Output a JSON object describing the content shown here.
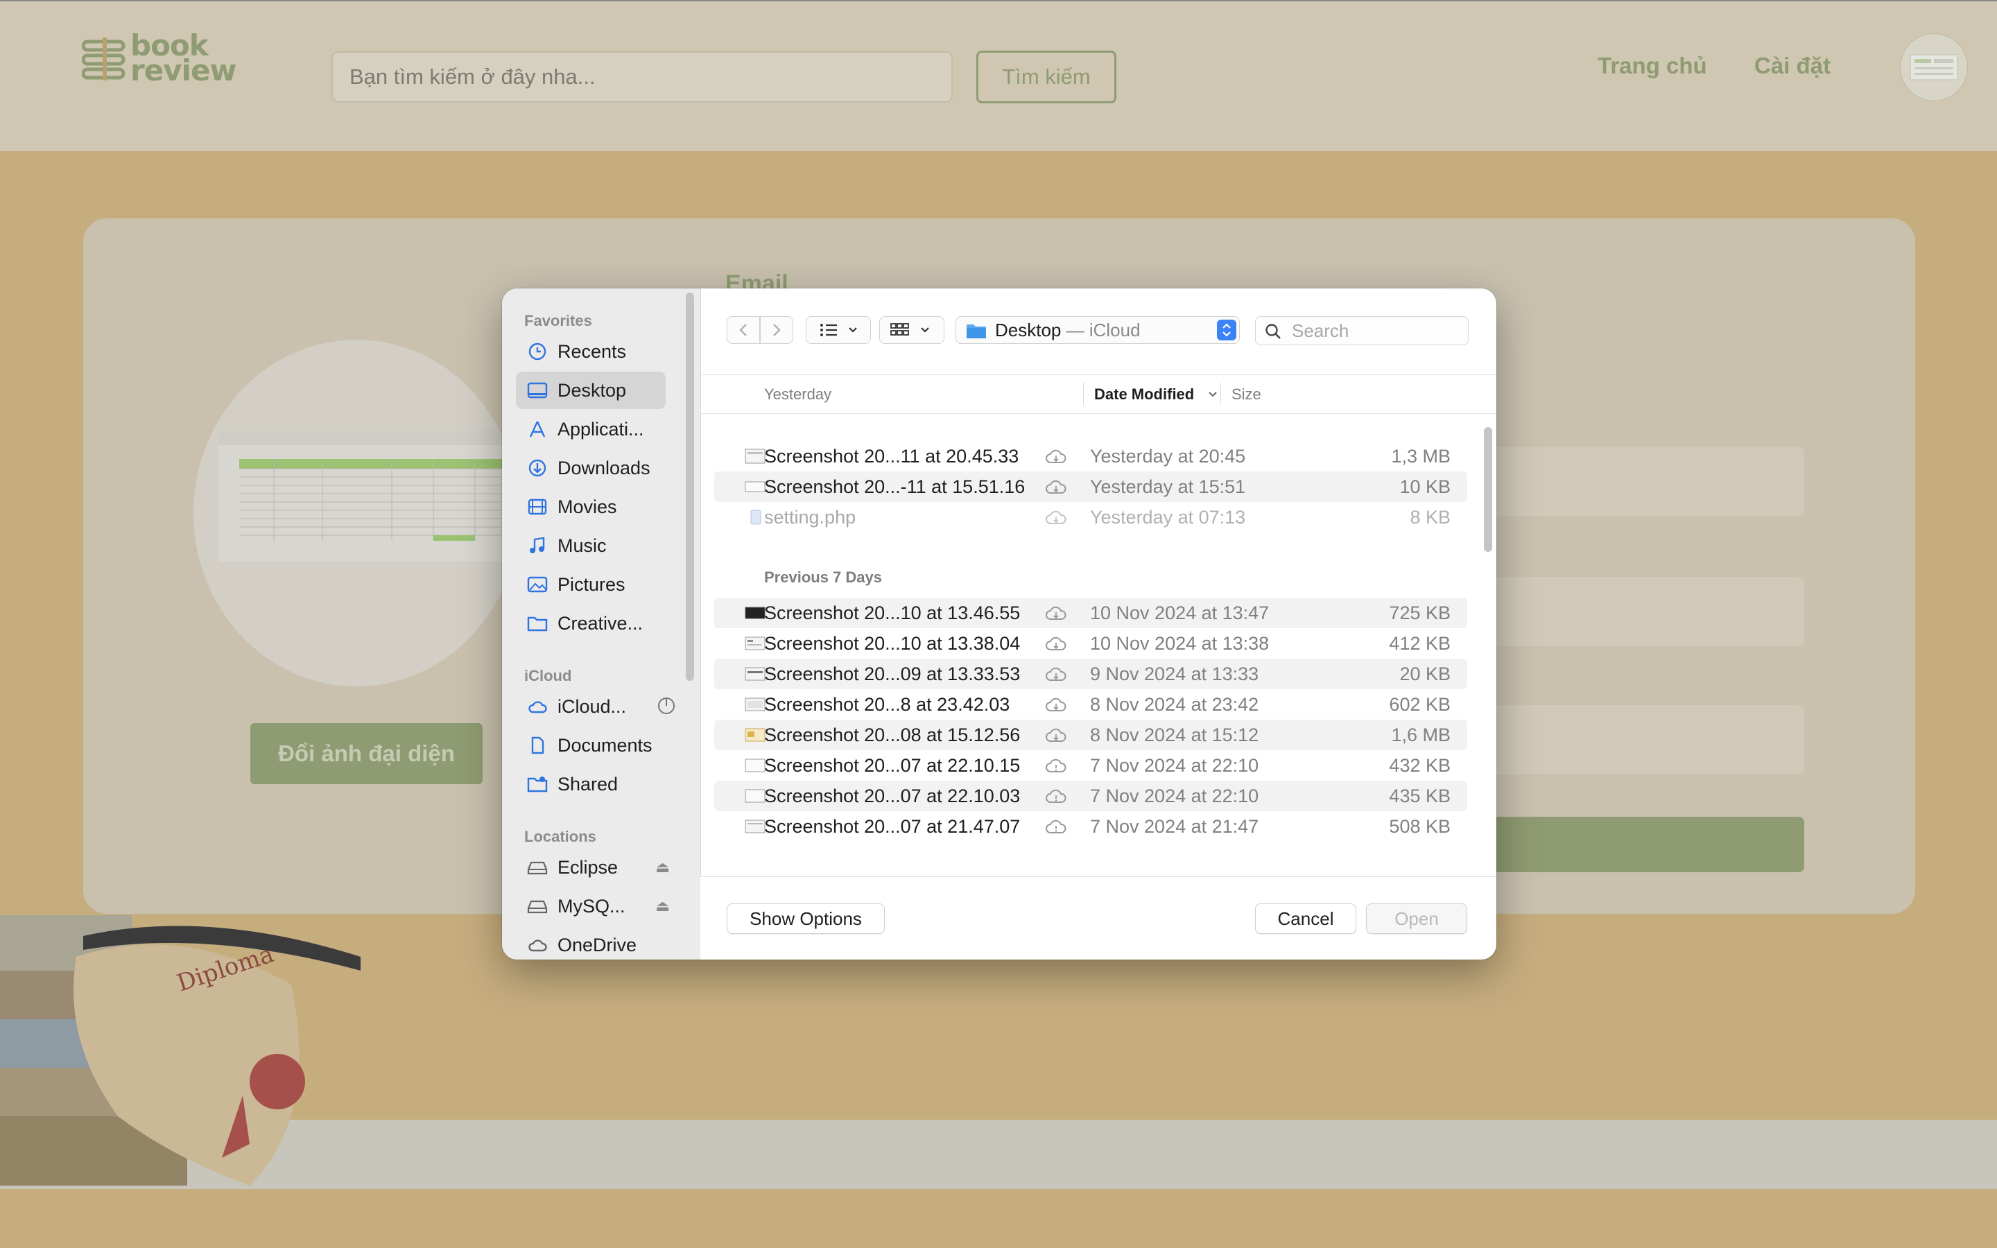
{
  "site": {
    "logo": {
      "line1": "book",
      "line2": "review"
    },
    "search": {
      "placeholder": "Bạn tìm kiếm ở đây nha...",
      "button": "Tìm kiếm"
    },
    "nav": {
      "home": "Trang chủ",
      "settings": "Cài đặt"
    },
    "profile": {
      "email_label": "Email",
      "change_avatar": "Đổi ảnh đại diện",
      "illustration_text": "Diploma"
    },
    "colors": {
      "brand": "#8f9b72",
      "header": "#cfc7b2",
      "background": "#c6ad7e"
    }
  },
  "dialog": {
    "sidebar": {
      "favorites_label": "Favorites",
      "favorites": [
        {
          "label": "Recents",
          "icon": "clock-icon"
        },
        {
          "label": "Desktop",
          "icon": "desktop-icon",
          "selected": true
        },
        {
          "label": "Applicati...",
          "icon": "applications-icon"
        },
        {
          "label": "Downloads",
          "icon": "download-icon"
        },
        {
          "label": "Movies",
          "icon": "film-icon"
        },
        {
          "label": "Music",
          "icon": "music-icon"
        },
        {
          "label": "Pictures",
          "icon": "photo-icon"
        },
        {
          "label": "Creative...",
          "icon": "folder-icon"
        }
      ],
      "icloud_label": "iCloud",
      "icloud": [
        {
          "label": "iCloud...",
          "icon": "cloud-icon"
        },
        {
          "label": "Documents",
          "icon": "document-icon"
        },
        {
          "label": "Shared",
          "icon": "shared-folder-icon"
        }
      ],
      "locations_label": "Locations",
      "locations": [
        {
          "label": "Eclipse",
          "icon": "drive-icon",
          "eject": "⏏"
        },
        {
          "label": "MySQ...",
          "icon": "drive-icon",
          "eject": "⏏"
        },
        {
          "label": "OneDrive",
          "icon": "cloud-icon"
        }
      ]
    },
    "toolbar": {
      "path_folder": "Desktop",
      "path_location": " — iCloud",
      "search_placeholder": "Search"
    },
    "columns": {
      "name": "Yesterday",
      "date": "Date Modified",
      "size": "Size"
    },
    "groups": [
      {
        "label": "",
        "files": [
          {
            "name": "Screenshot 20...11 at 20.45.33",
            "date": "Yesterday at 20:45",
            "size": "1,3 MB"
          },
          {
            "name": "Screenshot 20...-11 at 15.51.16",
            "date": "Yesterday at 15:51",
            "size": "10 KB"
          },
          {
            "name": "setting.php",
            "date": "Yesterday at 07:13",
            "size": "8 KB",
            "disabled": true
          }
        ]
      },
      {
        "label": "Previous 7 Days",
        "files": [
          {
            "name": "Screenshot 20...10 at 13.46.55",
            "date": "10 Nov 2024 at 13:47",
            "size": "725 KB"
          },
          {
            "name": "Screenshot 20...10 at 13.38.04",
            "date": "10 Nov 2024 at 13:38",
            "size": "412 KB"
          },
          {
            "name": "Screenshot 20...09 at 13.33.53",
            "date": "9 Nov 2024 at 13:33",
            "size": "20 KB"
          },
          {
            "name": "Screenshot 20...8 at 23.42.03",
            "date": "8 Nov 2024 at 23:42",
            "size": "602 KB"
          },
          {
            "name": "Screenshot 20...08 at 15.12.56",
            "date": "8 Nov 2024 at 15:12",
            "size": "1,6 MB"
          },
          {
            "name": "Screenshot 20...07 at 22.10.15",
            "date": "7 Nov 2024 at 22:10",
            "size": "432 KB"
          },
          {
            "name": "Screenshot 20...07 at 22.10.03",
            "date": "7 Nov 2024 at 22:10",
            "size": "435 KB"
          },
          {
            "name": "Screenshot 20...07 at 21.47.07",
            "date": "7 Nov 2024 at 21:47",
            "size": "508 KB"
          }
        ]
      }
    ],
    "footer": {
      "show_options": "Show Options",
      "cancel": "Cancel",
      "open": "Open"
    }
  }
}
